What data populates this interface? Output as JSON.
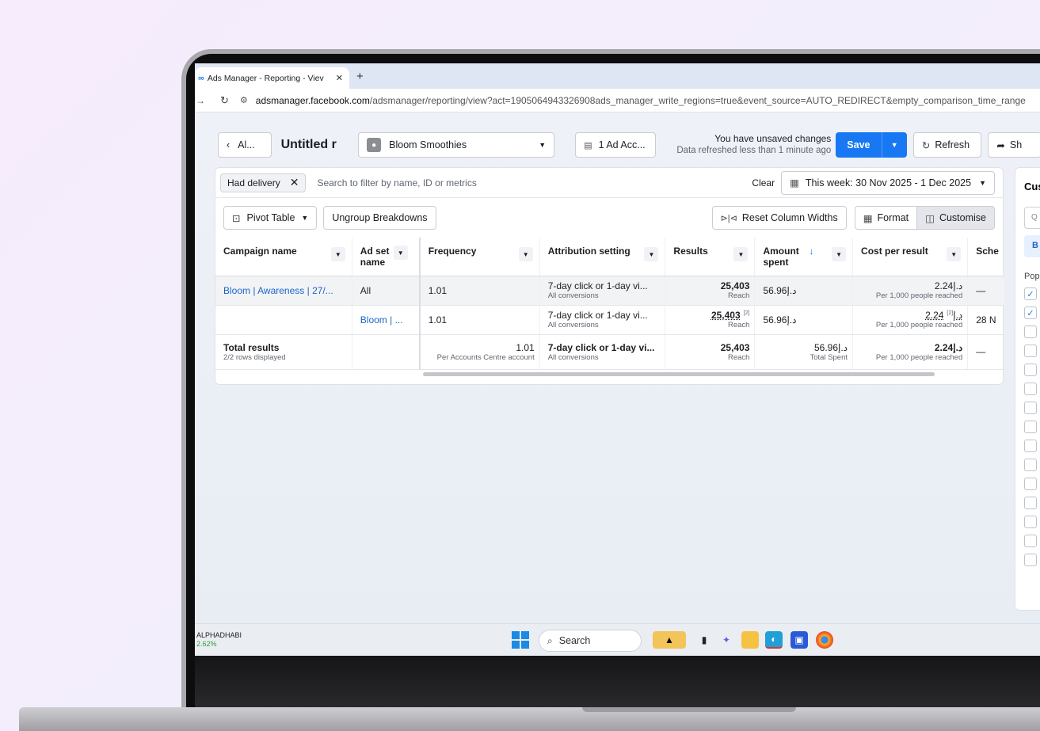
{
  "browser": {
    "tab_title": "Ads Manager - Reporting - Viev",
    "tab_close": "✕",
    "new_tab": "+",
    "url_host": "adsmanager.facebook.com",
    "url_path": "/adsmanager/reporting/view?act=1905064943326908ads_manager_write_regions=true&event_source=AUTO_REDIRECT&empty_comparison_time_range"
  },
  "header": {
    "back_label": "Al...",
    "report_title": "Untitled r",
    "account_name": "Bloom Smoothies",
    "ad_accounts_label": "1 Ad Acc...",
    "unsaved_msg": "You have unsaved changes",
    "refreshed_msg": "Data refreshed less than 1 minute ago",
    "save_label": "Save",
    "refresh_label": "Refresh",
    "share_label": "Sh"
  },
  "filters": {
    "chip_label": "Had delivery",
    "search_placeholder": "Search to filter by name, ID or metrics",
    "clear_label": "Clear",
    "date_range": "This week: 30 Nov 2025 - 1 Dec 2025"
  },
  "toolbar": {
    "pivot_label": "Pivot Table",
    "ungroup_label": "Ungroup Breakdowns",
    "reset_label": "Reset Column Widths",
    "format_label": "Format",
    "customise_label": "Customise"
  },
  "table": {
    "headers": {
      "campaign": "Campaign name",
      "adset": "Ad set name",
      "frequency": "Frequency",
      "attribution": "Attribution setting",
      "results": "Results",
      "amount": "Amount spent",
      "amount_arrow": "↓",
      "cpr": "Cost per result",
      "schedule": "Sche"
    },
    "row1": {
      "campaign": "Bloom | Awareness | 27/...",
      "adset": "All",
      "frequency": "1.01",
      "attribution": "7-day click or 1-day vi...",
      "attribution_sub": "All conversions",
      "results": "25,403",
      "results_sub": "Reach",
      "amount": "56.96د.إ",
      "cpr": "2.24د.إ",
      "cpr_sub": "Per 1,000 people reached",
      "schedule": "—"
    },
    "row2": {
      "campaign": "",
      "adset": "Bloom | ...",
      "frequency": "1.01",
      "attribution": "7-day click or 1-day vi...",
      "attribution_sub": "All conversions",
      "results": "25,403",
      "results_note": "[2]",
      "results_sub": "Reach",
      "amount": "56.96د.إ",
      "cpr": "2.24د.إ",
      "cpr_note": "[2]",
      "cpr_sub": "Per 1,000 people reached",
      "schedule": "28 N"
    },
    "total": {
      "label": "Total results",
      "sub": "2/2 rows displayed",
      "frequency": "1.01",
      "frequency_sub": "Per Accounts Centre account",
      "attribution": "7-day click or 1-day vi...",
      "attribution_sub": "All conversions",
      "results": "25,403",
      "results_sub": "Reach",
      "amount": "56.96د.إ",
      "amount_sub": "Total Spent",
      "cpr": "2.24د.إ",
      "cpr_sub": "Per 1,000 people reached",
      "schedule": "—"
    }
  },
  "side_panel": {
    "title": "Cus",
    "search_icon_text": "Q",
    "pill_label": "B",
    "section_label": "Pop",
    "checkboxes": [
      true,
      true,
      false,
      false,
      false,
      false,
      false,
      false,
      false,
      false,
      false,
      false,
      false,
      false,
      false
    ]
  },
  "taskbar": {
    "ticker_name": "ALPHADHABI",
    "ticker_pct": "2.62%",
    "search_label": "Search"
  },
  "colors": {
    "accent": "#1877f2",
    "link": "#1b66c9"
  }
}
